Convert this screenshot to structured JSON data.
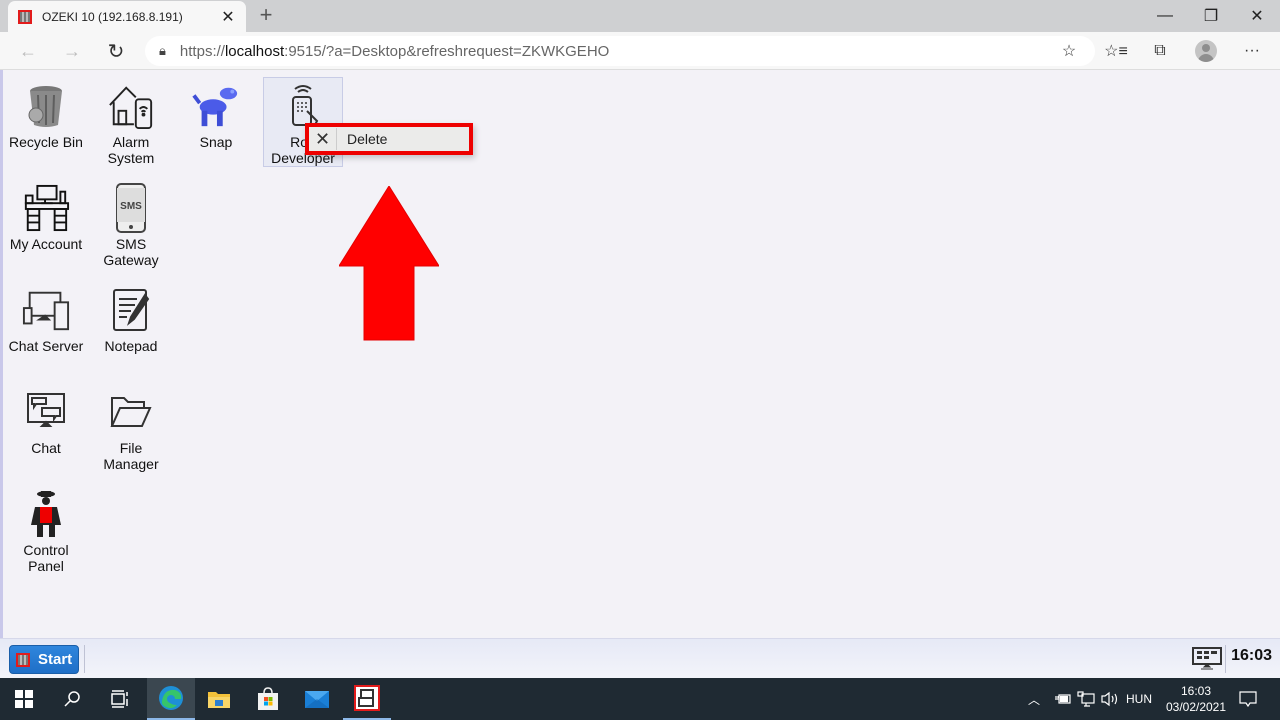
{
  "browser": {
    "tab_title": "OZEKI 10 (192.168.8.191)",
    "url_prefix": "https://",
    "url_host": "localhost",
    "url_rest": ":9515/?a=Desktop&refreshrequest=ZKWKGEHO",
    "icons": [
      "back-icon",
      "forward-icon",
      "reload-icon",
      "lock-icon",
      "add-favorite-icon",
      "favorites-icon",
      "collections-icon",
      "profile-icon",
      "more-icon"
    ]
  },
  "desktop": {
    "icons": [
      {
        "label": "Recycle Bin",
        "icon": "recycle-bin-icon"
      },
      {
        "label": "Alarm System",
        "icon": "alarm-system-icon"
      },
      {
        "label": "Snap",
        "icon": "snap-robot-dog-icon"
      },
      {
        "label": "Robot Developer",
        "label_visible": "Rob Developer",
        "icon": "robot-developer-icon",
        "selected": true
      },
      {
        "label": "My Account",
        "icon": "my-account-desk-icon"
      },
      {
        "label": "SMS Gateway",
        "icon": "sms-gateway-icon"
      },
      {
        "label": "Chat Server",
        "icon": "chat-server-icon"
      },
      {
        "label": "Notepad",
        "icon": "notepad-icon"
      },
      {
        "label": "Chat",
        "icon": "chat-icon"
      },
      {
        "label": "File Manager",
        "icon": "file-manager-icon"
      },
      {
        "label": "Control Panel",
        "icon": "control-panel-icon"
      }
    ],
    "labels": {
      "recycle": "Recycle Bin",
      "alarm1": "Alarm",
      "alarm2": "System",
      "snap": "Snap",
      "robot1": "Rob",
      "robot2": "Developer",
      "account": "My Account",
      "sms1": "SMS",
      "sms2": "Gateway",
      "chatserver": "Chat Server",
      "notepad": "Notepad",
      "chat": "Chat",
      "file1": "File",
      "file2": "Manager",
      "control1": "Control",
      "control2": "Panel"
    },
    "context_menu": {
      "items": [
        {
          "label": "Delete",
          "icon": "close-x-icon"
        }
      ],
      "highlight_color": "#ee0000"
    },
    "annotation": {
      "type": "arrow-up",
      "color": "#ff0000"
    }
  },
  "ozeki_taskbar": {
    "start_label": "Start",
    "clock": "16:03"
  },
  "windows_taskbar": {
    "apps": [
      "windows-start-icon",
      "search-icon",
      "task-view-icon",
      "edge-icon",
      "file-explorer-icon",
      "store-icon",
      "mail-icon",
      "ozeki-icon"
    ],
    "language": "HUN",
    "time": "16:03",
    "date": "03/02/2021"
  }
}
